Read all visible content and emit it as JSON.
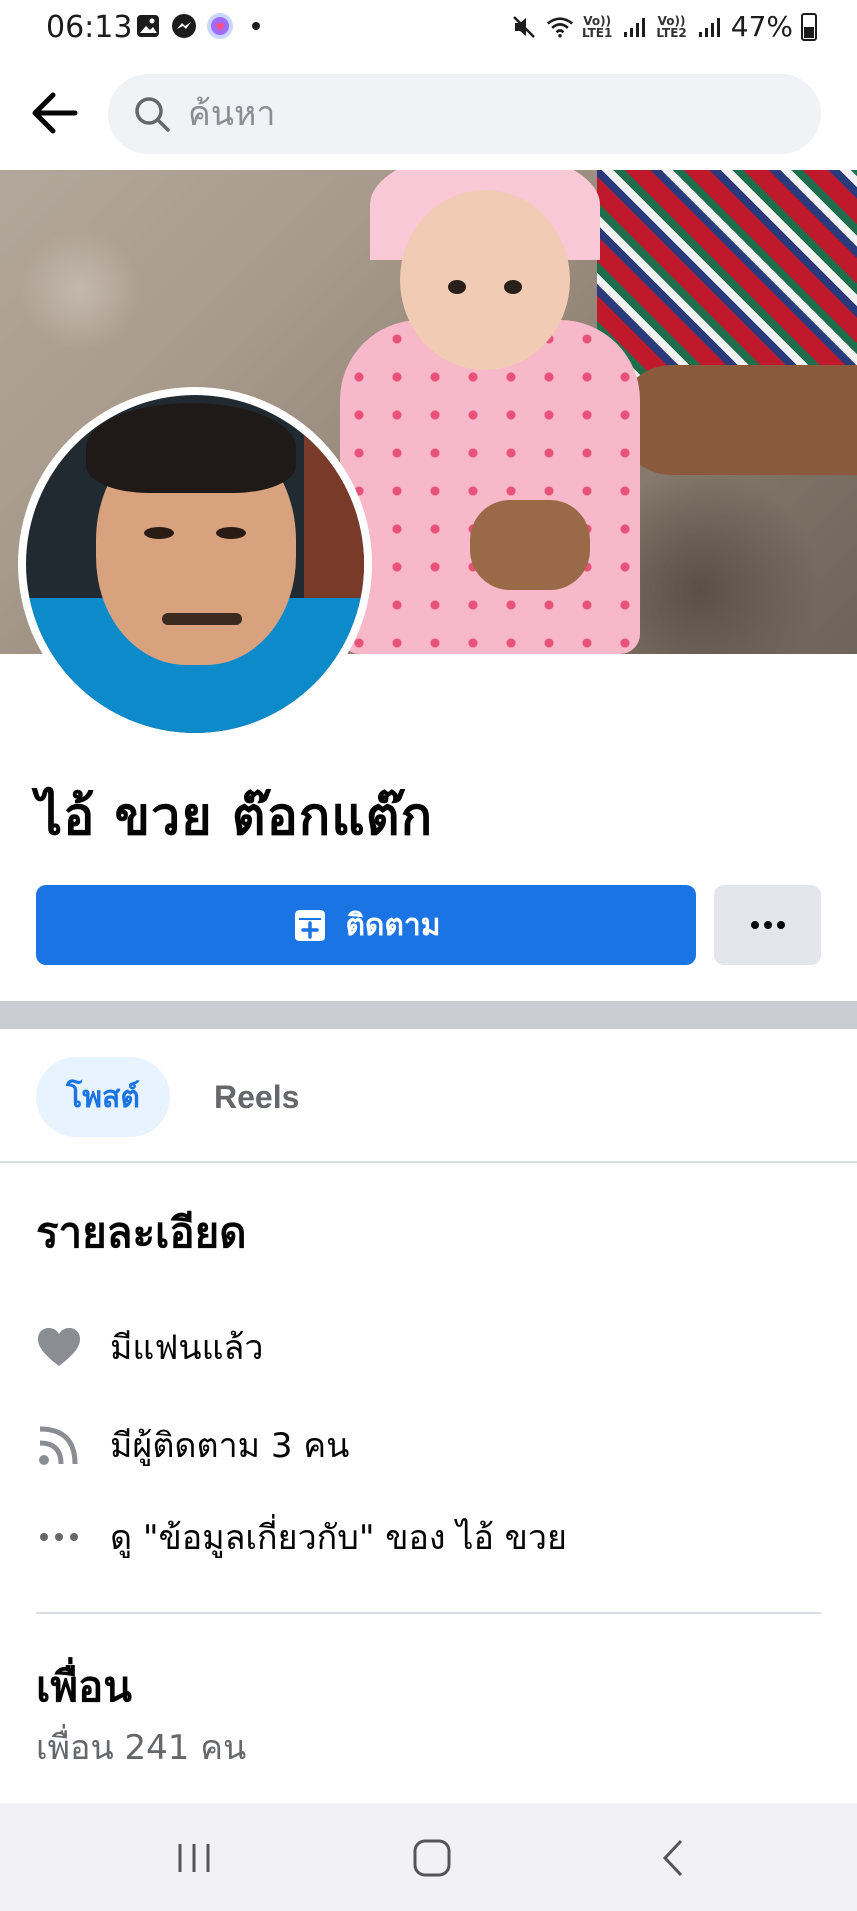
{
  "status_bar": {
    "time": "06:13",
    "sim1_label_top": "Vo))",
    "sim1_label_bottom": "LTE1",
    "sim2_label_top": "Vo))",
    "sim2_label_bottom": "LTE2",
    "battery_percent": "47%",
    "icons": [
      "gallery-icon",
      "messenger-icon",
      "app-notification-icon",
      "dot-icon",
      "mute-icon",
      "wifi-icon",
      "signal-icon",
      "battery-icon"
    ]
  },
  "header": {
    "search_placeholder": "ค้นหา",
    "back_icon": "arrow-left-icon",
    "search_icon": "search-icon"
  },
  "profile": {
    "name": "ไอ้ ขวย ต๊อกแต๊ก",
    "follow_label": "ติดตาม",
    "follow_icon": "follow-add-icon",
    "more_icon": "more-dots-icon"
  },
  "tabs": [
    {
      "label": "โพสต์",
      "active": true
    },
    {
      "label": "Reels",
      "active": false
    }
  ],
  "details": {
    "title": "รายละเอียด",
    "items": [
      {
        "icon": "heart-icon",
        "text": "มีแฟนแล้ว"
      },
      {
        "icon": "rss-followers-icon",
        "text": "มีผู้ติดตาม 3 คน"
      },
      {
        "icon": "ellipsis-icon",
        "text": "ดู \"ข้อมูลเกี่ยวกับ\" ของ ไอ้ ขวย"
      }
    ]
  },
  "friends": {
    "title": "เพื่อน",
    "count_text": "เพื่อน 241 คน"
  },
  "colors": {
    "primary_blue": "#1b74e4",
    "tab_active_bg": "#e7f3ff",
    "secondary_button_bg": "#e4e6eb",
    "divider": "#c9ccd1",
    "secondary_text": "#65676b"
  },
  "nav_bar": {
    "icons": [
      "recent-apps-icon",
      "home-icon",
      "back-nav-icon"
    ]
  }
}
